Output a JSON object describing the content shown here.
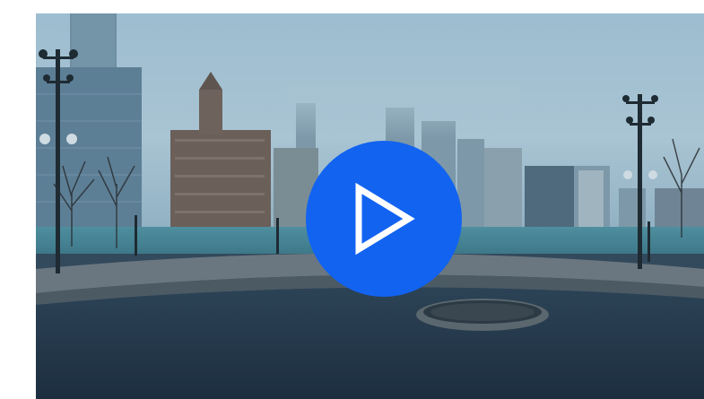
{
  "video_player": {
    "accent_color": "#1263f0",
    "play_button": {
      "icon": "play-icon"
    },
    "thumbnail": {
      "description_icon": "video-thumbnail"
    }
  }
}
